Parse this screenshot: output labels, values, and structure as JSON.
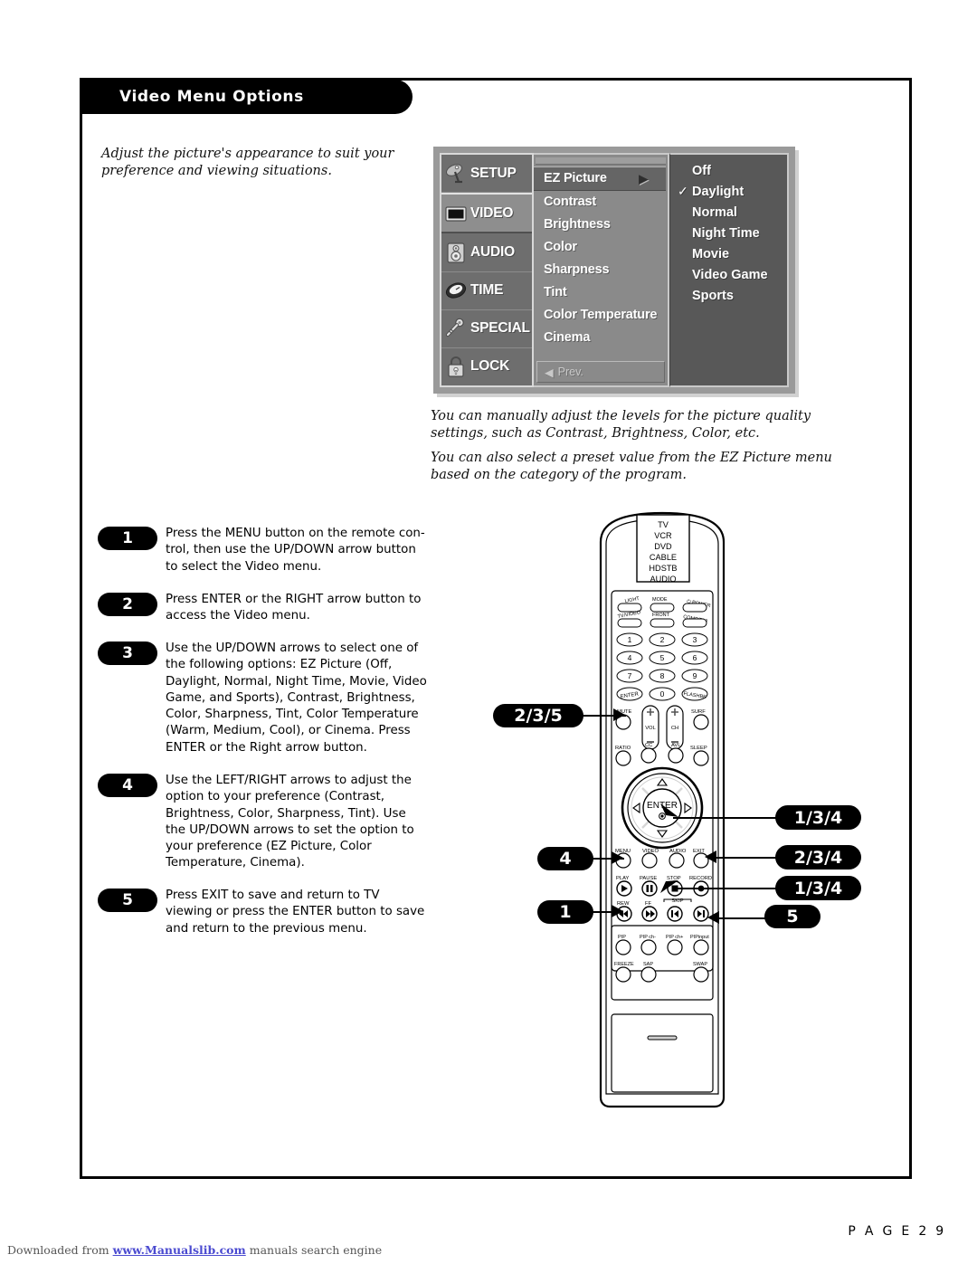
{
  "header": {
    "title": "Video Menu Options"
  },
  "intro": {
    "text": "Adjust the picture's appearance to suit your preference and viewing situations."
  },
  "descriptions": {
    "p1": "You can manually adjust the levels for the picture quality settings, such as Contrast, Brightness, Color, etc.",
    "p2": "You can also select a preset value from the EZ Picture menu based on the category of the program."
  },
  "osd": {
    "nav": [
      {
        "label": "SETUP",
        "icon": "satellite-dish-icon",
        "active": false
      },
      {
        "label": "VIDEO",
        "icon": "tv-screen-icon",
        "active": true
      },
      {
        "label": "AUDIO",
        "icon": "speaker-icon",
        "active": false
      },
      {
        "label": "TIME",
        "icon": "clock-icon",
        "active": false
      },
      {
        "label": "SPECIAL",
        "icon": "key-icon",
        "active": false
      },
      {
        "label": "LOCK",
        "icon": "padlock-icon",
        "active": false
      }
    ],
    "list": [
      {
        "label": "EZ Picture",
        "selected": true,
        "arrow": "▶"
      },
      {
        "label": "Contrast",
        "selected": false,
        "arrow": ""
      },
      {
        "label": "Brightness",
        "selected": false,
        "arrow": ""
      },
      {
        "label": "Color",
        "selected": false,
        "arrow": ""
      },
      {
        "label": "Sharpness",
        "selected": false,
        "arrow": ""
      },
      {
        "label": "Tint",
        "selected": false,
        "arrow": ""
      },
      {
        "label": "Color Temperature",
        "selected": false,
        "arrow": ""
      },
      {
        "label": "Cinema",
        "selected": false,
        "arrow": ""
      }
    ],
    "prev": {
      "label": "Prev.",
      "arrow": "◀"
    },
    "options": [
      {
        "label": "Off",
        "checked": false
      },
      {
        "label": "Daylight",
        "checked": true
      },
      {
        "label": "Normal",
        "checked": false
      },
      {
        "label": "Night Time",
        "checked": false
      },
      {
        "label": "Movie",
        "checked": false
      },
      {
        "label": "Video Game",
        "checked": false
      },
      {
        "label": "Sports",
        "checked": false
      }
    ],
    "check_glyph": "✓"
  },
  "steps": [
    {
      "number": "1",
      "text": "Press the MENU button on the remote con-trol, then use the UP/DOWN arrow button to select the Video menu."
    },
    {
      "number": "2",
      "text": "Press ENTER or the RIGHT arrow button to access the Video menu."
    },
    {
      "number": "3",
      "text": "Use the UP/DOWN arrows to select one of the following options: EZ Picture (Off, Daylight, Normal, Night Time, Movie, Video Game, and Sports), Contrast, Brightness, Color, Sharpness, Tint, Color Temperature (Warm, Medium, Cool), or Cinema. Press ENTER or the Right arrow button."
    },
    {
      "number": "4",
      "text": "Use the LEFT/RIGHT arrows to adjust the option to your preference (Contrast, Brightness, Color, Sharpness, Tint). Use the UP/DOWN arrows to set the option to your preference (EZ Picture, Color Temperature, Cinema)."
    },
    {
      "number": "5",
      "text": "Press EXIT to save and return to TV viewing or press the ENTER button to save and return to the previous menu."
    }
  ],
  "callouts": {
    "enter_key": "2/3/5",
    "up_arrow": "1/3/4",
    "right_arrow": "2/3/4",
    "down_arrow": "1/3/4",
    "exit_button": "5",
    "left_arrow": "4",
    "menu_button": "1"
  },
  "remote": {
    "device_list": [
      "TV",
      "VCR",
      "DVD",
      "CABLE",
      "HDSTB",
      "AUDIO"
    ],
    "row_light_mode_power": [
      "LIGHT",
      "MODE",
      "POWER"
    ],
    "row_inputs": [
      "TV/VIDEO",
      "FRONT",
      "COMP/DVI"
    ],
    "keypad": [
      "1",
      "2",
      "3",
      "4",
      "5",
      "6",
      "7",
      "8",
      "9",
      "ENTER",
      "0",
      "FLASHBK"
    ],
    "row_mute_surf": [
      "MUTE",
      "VOL",
      "CH",
      "SURF"
    ],
    "row_ratio_sleep": [
      "RATIO",
      "CC",
      "AVL",
      "SLEEP"
    ],
    "dpad_center": "ENTER",
    "row_menu_exit": [
      "MENU",
      "VIDEO",
      "AUDIO",
      "EXIT"
    ],
    "row_transport": [
      "PLAY",
      "PAUSE",
      "STOP",
      "RECORD"
    ],
    "row_transport2": [
      "REW",
      "FF",
      "SKIP"
    ],
    "row_pip": [
      "PIP",
      "PIP ch-",
      "PIP ch+",
      "PIPinput"
    ],
    "row_pip2": [
      "FREEZE",
      "SAP",
      "SWAP"
    ]
  },
  "footer": {
    "page_label": "P A G E   2 9",
    "download_prefix": "Downloaded from ",
    "download_link": "www.Manualslib.com",
    "download_suffix": " manuals search engine"
  }
}
